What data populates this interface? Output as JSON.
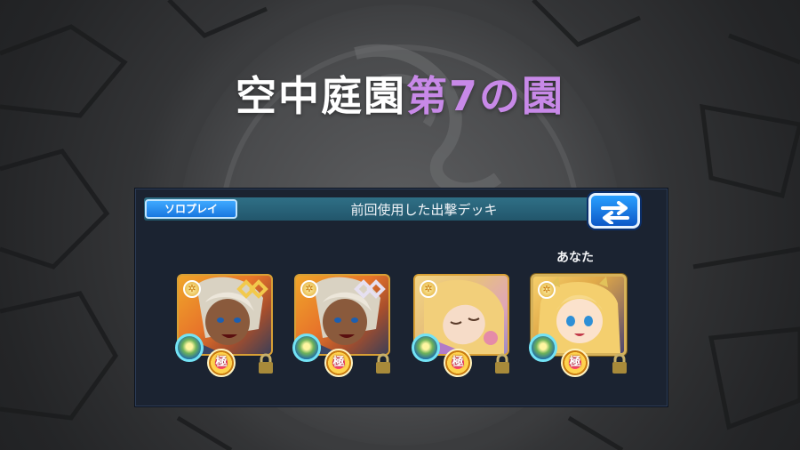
{
  "title": {
    "main": "空中庭園",
    "accent": "第7の園"
  },
  "deck": {
    "mode_tab": "ソロプレイ",
    "header_text": "前回使用した出撃デッキ",
    "owner_label": "あなた",
    "swap_icon": "swap-arrows-icon",
    "slots": [
      {
        "portrait": "gray-haired-warrior",
        "rank": "極",
        "link_icon": "gold-link-icon",
        "locked": true
      },
      {
        "portrait": "gray-haired-warrior",
        "rank": "極",
        "link_icon": "silver-link-icon",
        "locked": true
      },
      {
        "portrait": "blonde-sleeping-girl",
        "rank": "極",
        "locked": true
      },
      {
        "portrait": "blonde-horned-girl",
        "rank": "極",
        "locked": true
      }
    ]
  },
  "colors": {
    "accent_text": "#c889e8",
    "panel_bg": "#1b2331",
    "header_bar": "#2f6f86",
    "button_blue": "#1877e0"
  }
}
